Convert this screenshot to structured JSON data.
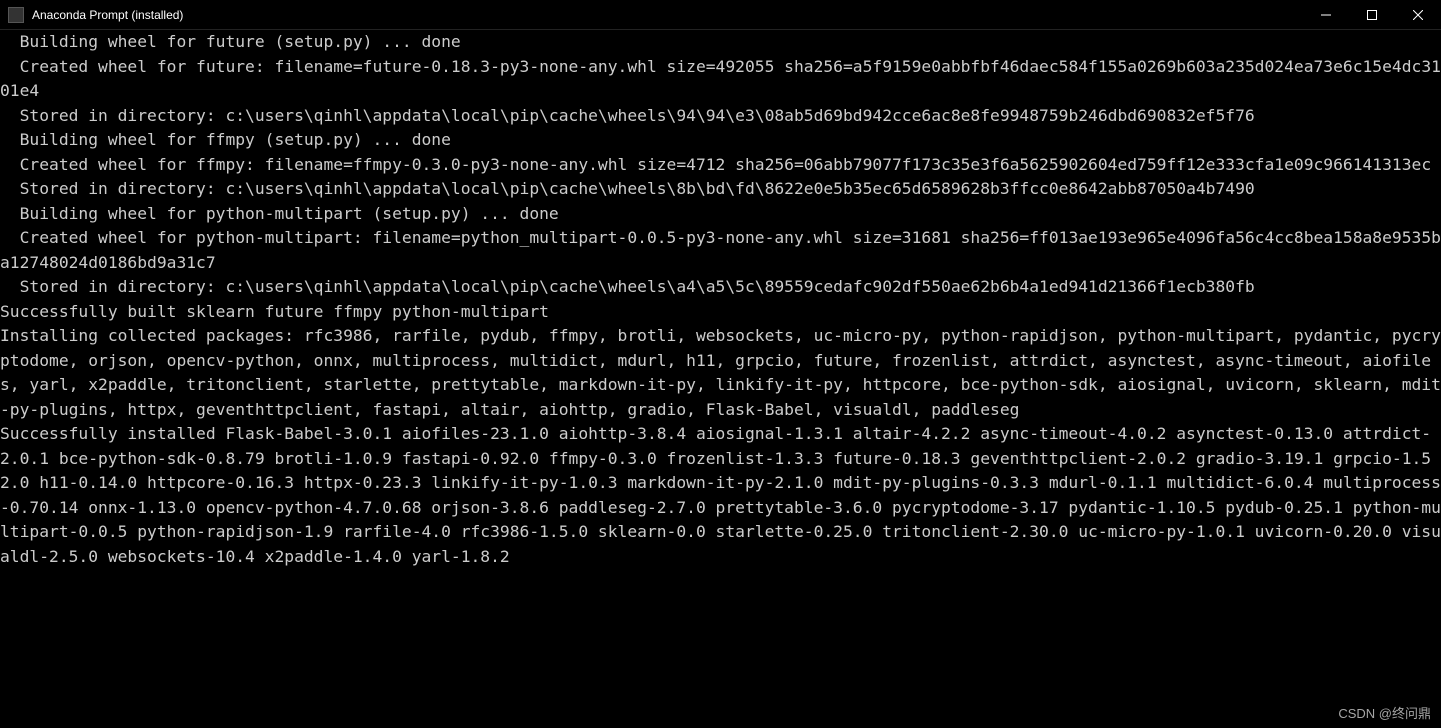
{
  "window": {
    "title": "Anaconda Prompt (installed)"
  },
  "terminal": {
    "lines": [
      "  Building wheel for future (setup.py) ... done",
      "  Created wheel for future: filename=future-0.18.3-py3-none-any.whl size=492055 sha256=a5f9159e0abbfbf46daec584f155a0269b603a235d024ea73e6c15e4dc3101e4",
      "  Stored in directory: c:\\users\\qinhl\\appdata\\local\\pip\\cache\\wheels\\94\\94\\e3\\08ab5d69bd942cce6ac8e8fe9948759b246dbd690832ef5f76",
      "  Building wheel for ffmpy (setup.py) ... done",
      "  Created wheel for ffmpy: filename=ffmpy-0.3.0-py3-none-any.whl size=4712 sha256=06abb79077f173c35e3f6a5625902604ed759ff12e333cfa1e09c966141313ec",
      "  Stored in directory: c:\\users\\qinhl\\appdata\\local\\pip\\cache\\wheels\\8b\\bd\\fd\\8622e0e5b35ec65d6589628b3ffcc0e8642abb87050a4b7490",
      "  Building wheel for python-multipart (setup.py) ... done",
      "  Created wheel for python-multipart: filename=python_multipart-0.0.5-py3-none-any.whl size=31681 sha256=ff013ae193e965e4096fa56c4cc8bea158a8e9535ba12748024d0186bd9a31c7",
      "  Stored in directory: c:\\users\\qinhl\\appdata\\local\\pip\\cache\\wheels\\a4\\a5\\5c\\89559cedafc902df550ae62b6b4a1ed941d21366f1ecb380fb",
      "Successfully built sklearn future ffmpy python-multipart",
      "Installing collected packages: rfc3986, rarfile, pydub, ffmpy, brotli, websockets, uc-micro-py, python-rapidjson, python-multipart, pydantic, pycryptodome, orjson, opencv-python, onnx, multiprocess, multidict, mdurl, h11, grpcio, future, frozenlist, attrdict, asynctest, async-timeout, aiofiles, yarl, x2paddle, tritonclient, starlette, prettytable, markdown-it-py, linkify-it-py, httpcore, bce-python-sdk, aiosignal, uvicorn, sklearn, mdit-py-plugins, httpx, geventhttpclient, fastapi, altair, aiohttp, gradio, Flask-Babel, visualdl, paddleseg",
      "Successfully installed Flask-Babel-3.0.1 aiofiles-23.1.0 aiohttp-3.8.4 aiosignal-1.3.1 altair-4.2.2 async-timeout-4.0.2 asynctest-0.13.0 attrdict-2.0.1 bce-python-sdk-0.8.79 brotli-1.0.9 fastapi-0.92.0 ffmpy-0.3.0 frozenlist-1.3.3 future-0.18.3 geventhttpclient-2.0.2 gradio-3.19.1 grpcio-1.52.0 h11-0.14.0 httpcore-0.16.3 httpx-0.23.3 linkify-it-py-1.0.3 markdown-it-py-2.1.0 mdit-py-plugins-0.3.3 mdurl-0.1.1 multidict-6.0.4 multiprocess-0.70.14 onnx-1.13.0 opencv-python-4.7.0.68 orjson-3.8.6 paddleseg-2.7.0 prettytable-3.6.0 pycryptodome-3.17 pydantic-1.10.5 pydub-0.25.1 python-multipart-0.0.5 python-rapidjson-1.9 rarfile-4.0 rfc3986-1.5.0 sklearn-0.0 starlette-0.25.0 tritonclient-2.30.0 uc-micro-py-1.0.1 uvicorn-0.20.0 visualdl-2.5.0 websockets-10.4 x2paddle-1.4.0 yarl-1.8.2"
    ]
  },
  "watermark": {
    "text": "CSDN @终问鼎"
  }
}
